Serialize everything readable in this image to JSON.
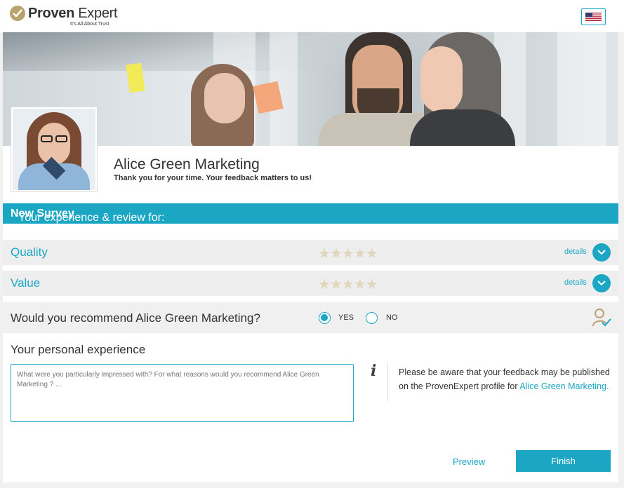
{
  "header": {
    "logo_text_bold": "Proven",
    "logo_text_regular": " Expert",
    "logo_tagline": "It's All About Trust",
    "language_icon": "us-flag-icon"
  },
  "profile": {
    "company_name": "Alice Green Marketing",
    "thank_you": "Thank you for your time. Your feedback matters to us!"
  },
  "survey_bar": {
    "prefix": "Your experience & review for: ",
    "survey_name": "New Survey"
  },
  "ratings": [
    {
      "label": "Quality",
      "stars": 0,
      "max_stars": 5,
      "details_label": "details"
    },
    {
      "label": "Value",
      "stars": 0,
      "max_stars": 5,
      "details_label": "details"
    }
  ],
  "recommend": {
    "question": "Would you recommend Alice Green Marketing?",
    "yes_label": "YES",
    "no_label": "NO",
    "selected": "YES"
  },
  "experience": {
    "title": "Your personal experience",
    "placeholder": "What were you particularly impressed with? For what reasons would you recommend Alice Green Marketing ? ...",
    "notice_text": "Please be aware that your feedback may be published on the ProvenExpert profile for ",
    "notice_link": "Alice Green Marketing."
  },
  "actions": {
    "preview_label": "Preview",
    "finish_label": "Finish"
  },
  "colors": {
    "accent": "#1ba6c4",
    "gold": "#b9a36d",
    "star_empty": "#e0d6bd"
  }
}
